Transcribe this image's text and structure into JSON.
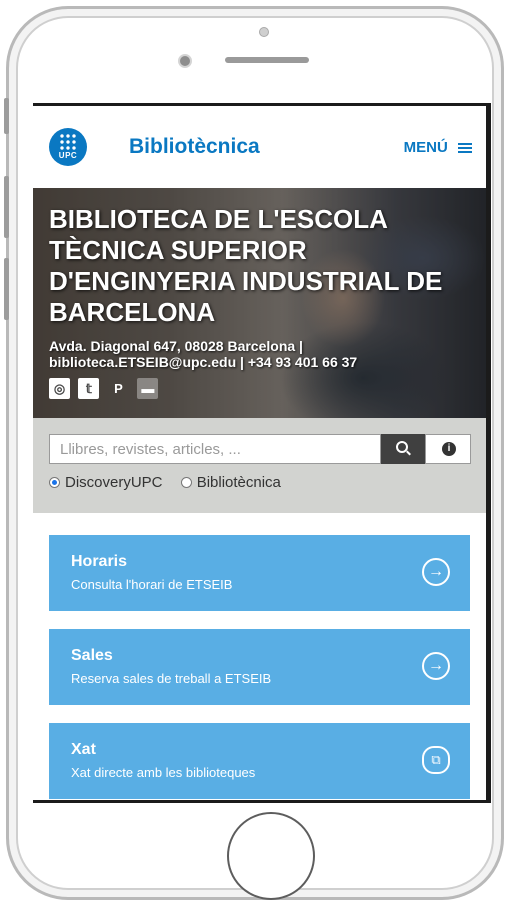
{
  "header": {
    "logo_text": "UPC",
    "site_title": "Bibliotècnica",
    "menu_label": "MENÚ"
  },
  "hero": {
    "title": "BIBLIOTECA DE L'ESCOLA TÈCNICA SUPERIOR D'ENGINYERIA INDUSTRIAL DE BARCELONA",
    "address_line": "Avda. Diagonal 647, 08028 Barcelona |",
    "contact_line": "biblioteca.ETSEIB@upc.edu | +34 93 401 66 37",
    "social_icons": [
      "instagram-icon",
      "twitter-icon",
      "pinterest-icon",
      "chat-icon"
    ]
  },
  "search": {
    "placeholder": "Llibres, revistes, articles, ...",
    "options": [
      "DiscoveryUPC",
      "Bibliotècnica"
    ],
    "selected": "DiscoveryUPC"
  },
  "cards": [
    {
      "title": "Horaris",
      "subtitle": "Consulta l'horari de ETSEIB",
      "icon": "arrow-right-icon"
    },
    {
      "title": "Sales",
      "subtitle": "Reserva sales de treball a ETSEIB",
      "icon": "arrow-right-icon"
    },
    {
      "title": "Xat",
      "subtitle": "Xat directe amb les biblioteques",
      "icon": "external-link-icon"
    }
  ],
  "colors": {
    "brand_blue": "#0a78c2",
    "card_blue": "#59aee4",
    "search_bg": "#d2d3d0"
  }
}
